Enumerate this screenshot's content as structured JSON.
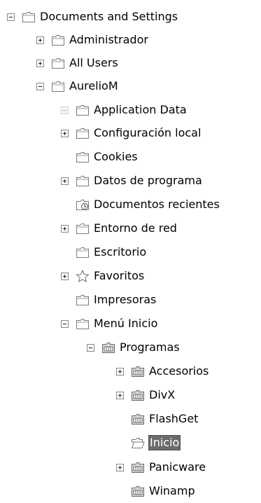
{
  "tree": {
    "root": {
      "label": "Documents and Settings",
      "toggle": "minus"
    },
    "items": [
      {
        "label": "Administrador",
        "toggle": "plus"
      },
      {
        "label": "All Users",
        "toggle": "plus"
      },
      {
        "label": "AurelioM",
        "toggle": "minus"
      },
      {
        "label": "Application Data",
        "toggle": "minus-faint"
      },
      {
        "label": "Configuración local",
        "toggle": "plus"
      },
      {
        "label": "Cookies",
        "toggle": "none"
      },
      {
        "label": "Datos de programa",
        "toggle": "plus"
      },
      {
        "label": "Documentos recientes",
        "toggle": "none"
      },
      {
        "label": "Entorno de red",
        "toggle": "plus"
      },
      {
        "label": "Escritorio",
        "toggle": "none"
      },
      {
        "label": "Favoritos",
        "toggle": "plus"
      },
      {
        "label": "Impresoras",
        "toggle": "none"
      },
      {
        "label": "Menú Inicio",
        "toggle": "minus"
      },
      {
        "label": "Programas",
        "toggle": "minus"
      },
      {
        "label": "Accesorios",
        "toggle": "plus"
      },
      {
        "label": "DivX",
        "toggle": "plus"
      },
      {
        "label": "FlashGet",
        "toggle": "none"
      },
      {
        "label": "Inicio",
        "toggle": "none",
        "selected": true
      },
      {
        "label": "Panicware",
        "toggle": "plus"
      },
      {
        "label": "Winamp",
        "toggle": "none"
      }
    ]
  },
  "colors": {
    "folder_fill": "#ffffff",
    "folder_stroke": "#7a7a7a",
    "program_folder_fill": "#d9d9d9",
    "selection": "#6b6b6b"
  }
}
